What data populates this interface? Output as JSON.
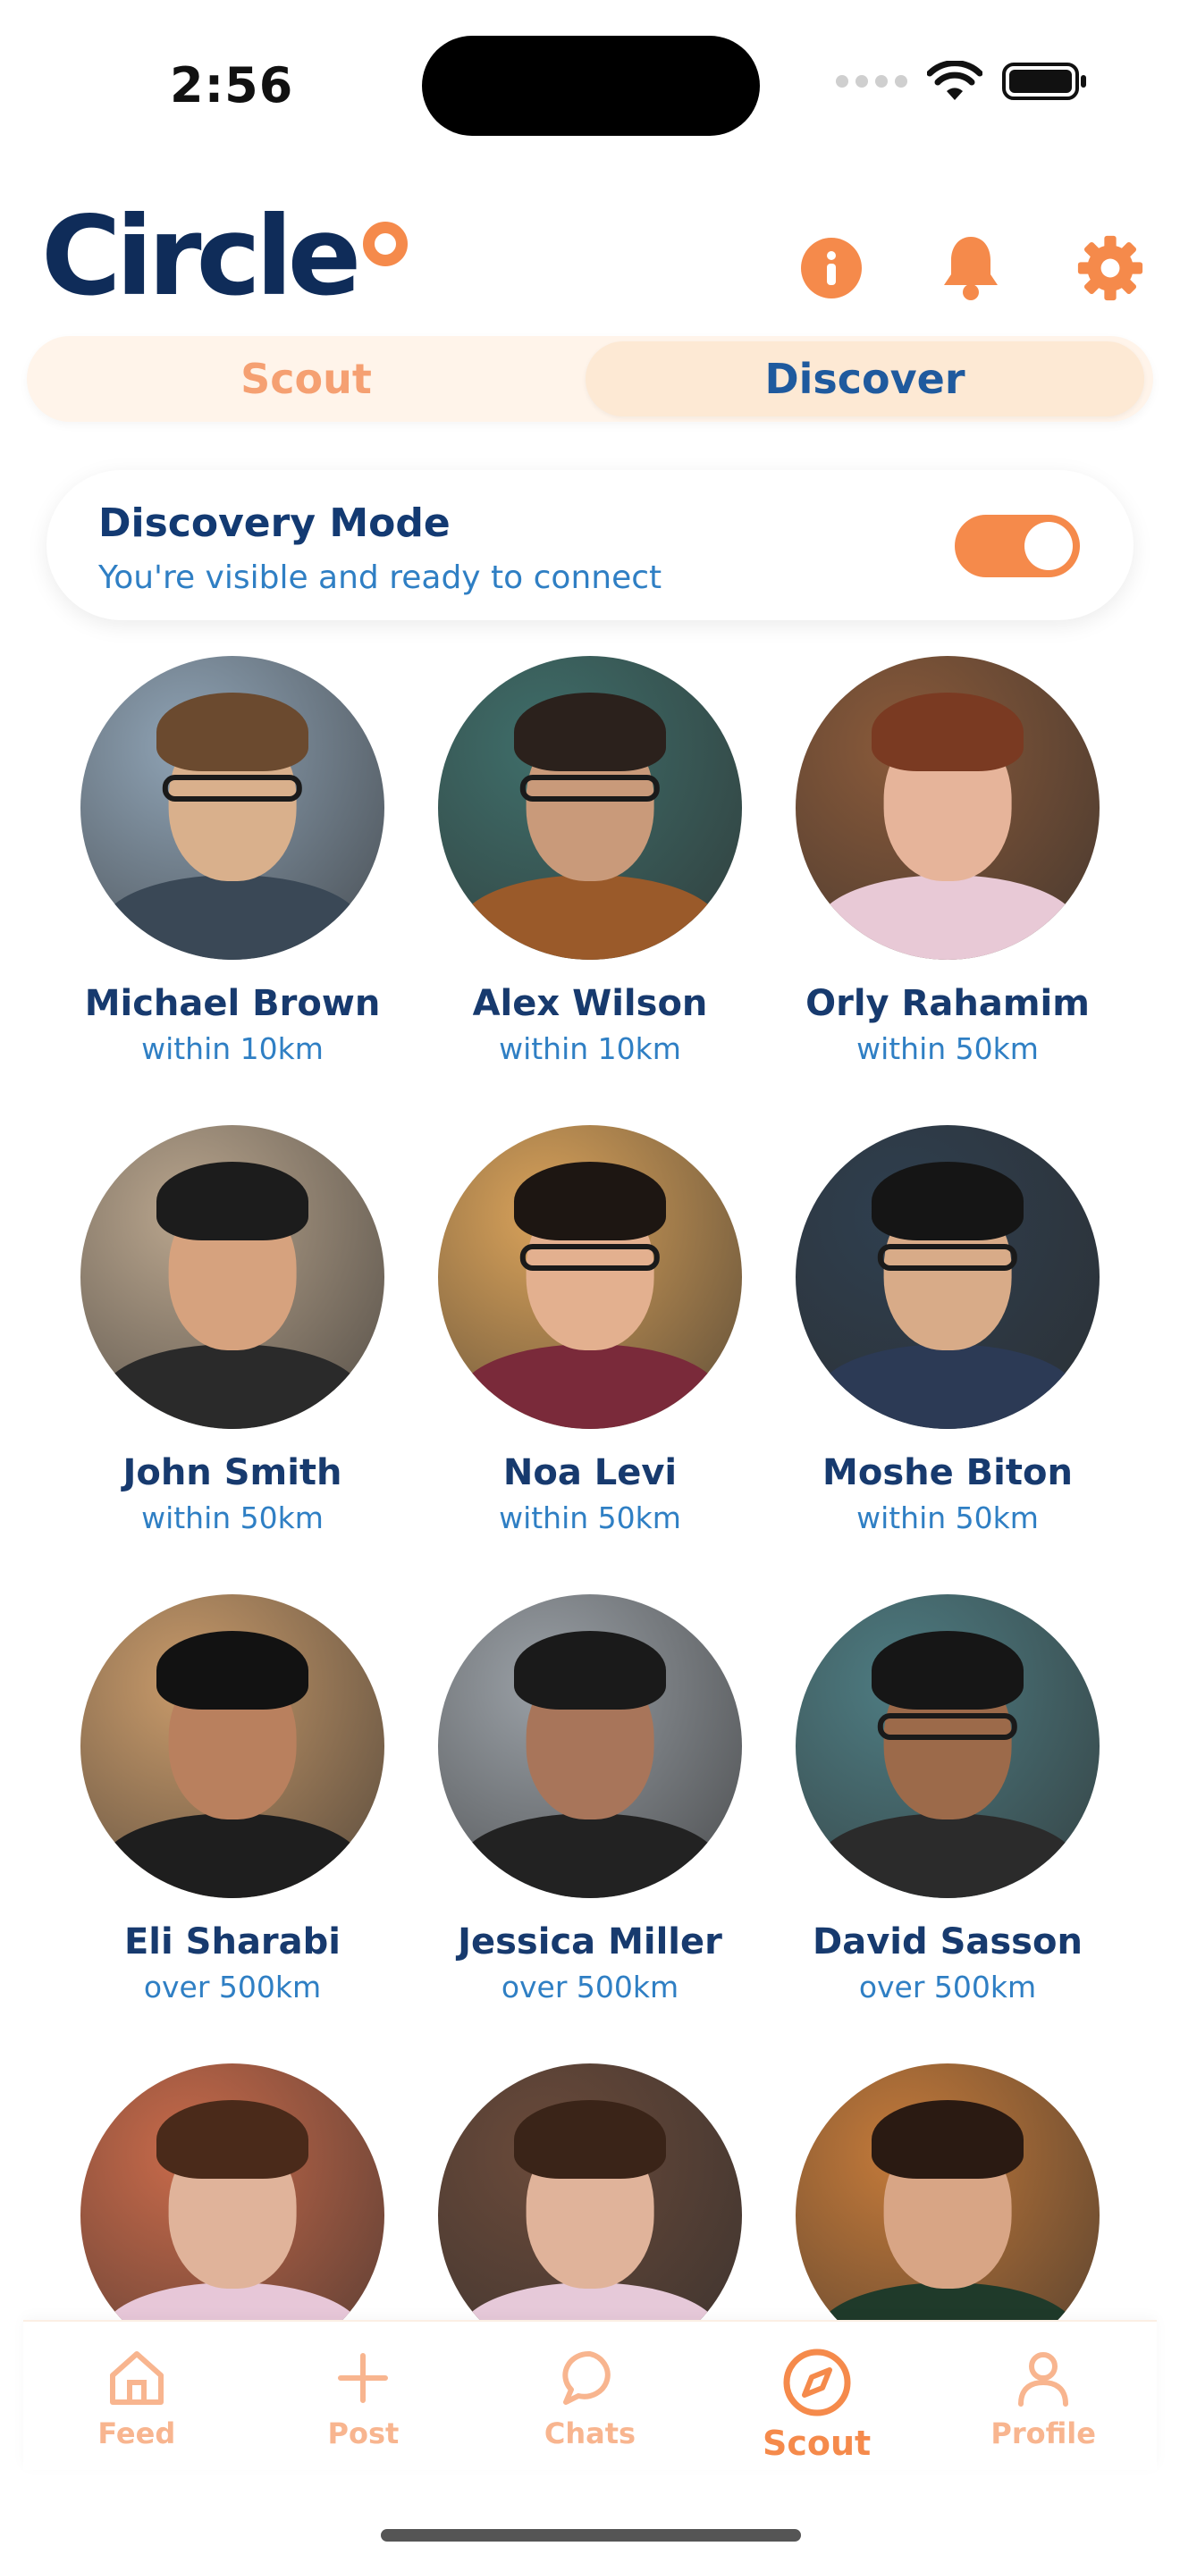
{
  "status_bar": {
    "time": "2:56"
  },
  "header": {
    "logo_text": "Circle",
    "icons": [
      "info-icon",
      "bell-icon",
      "gear-icon"
    ]
  },
  "tabs": [
    {
      "label": "Scout",
      "active": false
    },
    {
      "label": "Discover",
      "active": true
    }
  ],
  "discovery": {
    "title": "Discovery Mode",
    "subtitle": "You're visible and ready to connect",
    "enabled": true
  },
  "people": [
    {
      "name": "Michael Brown",
      "distance": "within 10km"
    },
    {
      "name": "Alex Wilson",
      "distance": "within 10km"
    },
    {
      "name": "Orly Rahamim",
      "distance": "within 50km"
    },
    {
      "name": "John Smith",
      "distance": "within 50km"
    },
    {
      "name": "Noa Levi",
      "distance": "within 50km"
    },
    {
      "name": "Moshe Biton",
      "distance": "within 50km"
    },
    {
      "name": "Eli Sharabi",
      "distance": "over 500km"
    },
    {
      "name": "Jessica Miller",
      "distance": "over 500km"
    },
    {
      "name": "David Sasson",
      "distance": "over 500km"
    },
    {
      "name": "",
      "distance": ""
    },
    {
      "name": "",
      "distance": ""
    },
    {
      "name": "",
      "distance": ""
    }
  ],
  "bottom_nav": [
    {
      "label": "Feed",
      "icon": "home-icon",
      "active": false
    },
    {
      "label": "Post",
      "icon": "plus-icon",
      "active": false
    },
    {
      "label": "Chats",
      "icon": "chat-bubble-icon",
      "active": false
    },
    {
      "label": "Scout",
      "icon": "compass-icon",
      "active": true
    },
    {
      "label": "Profile",
      "icon": "user-icon",
      "active": false
    }
  ],
  "colors": {
    "accent": "#f58a4b",
    "navy": "#0f2c59",
    "link_blue": "#2f7fc4"
  }
}
